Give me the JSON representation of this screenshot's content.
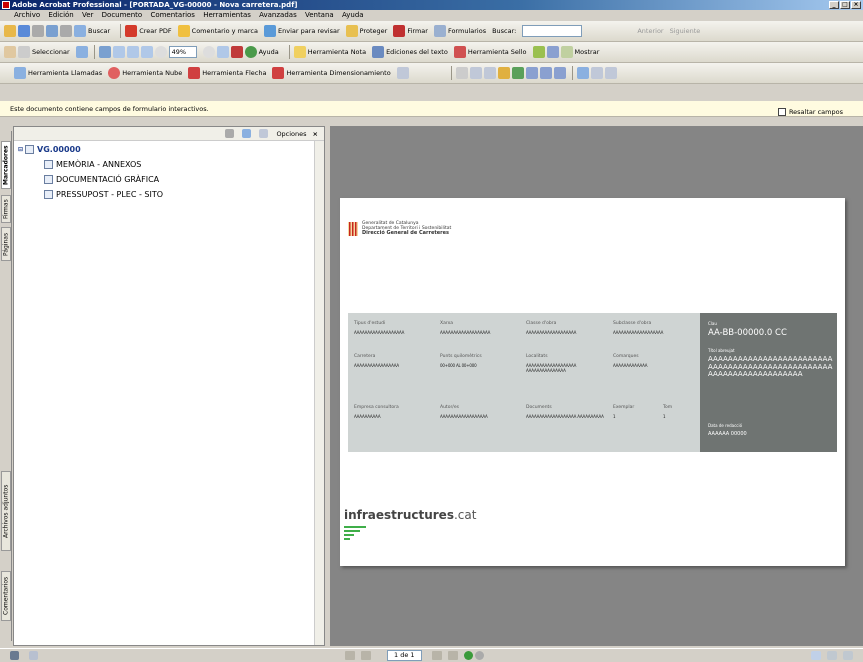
{
  "window": {
    "title": "Adobe Acrobat Professional - [PORTADA_VG-00000 - Nova carretera.pdf]",
    "controls": [
      "_",
      "□",
      "×"
    ]
  },
  "menu": [
    "Archivo",
    "Edición",
    "Ver",
    "Documento",
    "Comentarios",
    "Herramientas",
    "Avanzadas",
    "Ventana",
    "Ayuda"
  ],
  "toolbar1": {
    "search_label": "Buscar",
    "create_pdf": "Crear PDF",
    "comment_mark": "Comentario y marca",
    "send_review": "Enviar para revisar",
    "protect": "Proteger",
    "sign": "Firmar",
    "forms": "Formularios",
    "find_label": "Buscar:",
    "find_value": "",
    "prev": "Anterior",
    "next": "Siguiente"
  },
  "toolbar2": {
    "select": "Seleccionar",
    "zoom": "49%",
    "help": "Ayuda",
    "note_tool": "Herramienta Nota",
    "text_edits": "Ediciones del texto",
    "stamp_tool": "Herramienta Sello",
    "show": "Mostrar"
  },
  "toolbar3": {
    "callout": "Herramienta Llamadas",
    "cloud": "Herramienta Nube",
    "arrow": "Herramienta Flecha",
    "dimension": "Herramienta Dimensionamiento"
  },
  "infobar": {
    "message": "Este documento contiene campos de formulario interactivos.",
    "highlight": "Resaltar campos"
  },
  "sidetabs": [
    "Marcadores",
    "Firmas",
    "Páginas",
    "Archivos adjuntos",
    "Comentarios"
  ],
  "navpanel": {
    "options": "Opciones",
    "close": "×",
    "root": "VG.00000",
    "items": [
      "MEMÒRIA - ANNEXOS",
      "DOCUMENTACIÓ GRÀFICA",
      "PRESSUPOST - PLEC - SITO"
    ]
  },
  "page": {
    "org1": "Generalitat de Catalunya",
    "org2": "Departament de Territori i Sostenibilitat",
    "org3": "Direcció General de Carreteres",
    "grid": [
      {
        "h": "Tipus d'estudi",
        "v": "AAAAAAAAAAAAAAAAAAA"
      },
      {
        "h": "Xarxa",
        "v": "AAAAAAAAAAAAAAAAAAA"
      },
      {
        "h": "Classe d'obra",
        "v": "AAAAAAAAAAAAAAAAAAA"
      },
      {
        "h": "Subclasse d'obra",
        "v": "AAAAAAAAAAAAAAAAAAA"
      },
      {
        "h": "Carretera",
        "v": "AAAAAAAAAAAAAAAAA"
      },
      {
        "h": "Punts quilomètrics",
        "v": "00+000 AL 00+000"
      },
      {
        "h": "Localitats",
        "v": "AAAAAAAAAAAAAAAAAAA AAAAAAAAAAAAAAA"
      },
      {
        "h": "Comarques",
        "v": "AAAAAAAAAAAAA"
      },
      {
        "h": "Empresa consultora",
        "v": "AAAAAAAAAA"
      },
      {
        "h": "Autor/es",
        "v": "AAAAAAAAAAAAAAAAAA"
      },
      {
        "h": "Documents",
        "v": "AAAAAAAAAAAAAAAAAAA AAAAAAAAAA"
      },
      {
        "h": "Exemplar",
        "v": "1"
      }
    ],
    "tom_label": "Tom",
    "tom_value": "1",
    "clau_label": "Clau",
    "clau_value": "AA-BB-00000.0 CC",
    "titol_label": "Títol abreujat",
    "titol_value": "AAAAAAAAAAAAAAAAAAAAAAAAA AAAAAAAAAAAAAAAAAAAAAAAAA AAAAAAAAAAAAAAAAAAA",
    "data_label": "Data de redacció",
    "data_value": "AAAAAA 00000",
    "brand_a": "infraestructures",
    "brand_b": ".cat"
  },
  "status": {
    "page": "1 de 1"
  },
  "colors": {
    "accent_green": "#3fae49",
    "grid_bg": "#cfd4d3",
    "dark_panel": "#6f7472",
    "doc_bg": "#858585"
  }
}
